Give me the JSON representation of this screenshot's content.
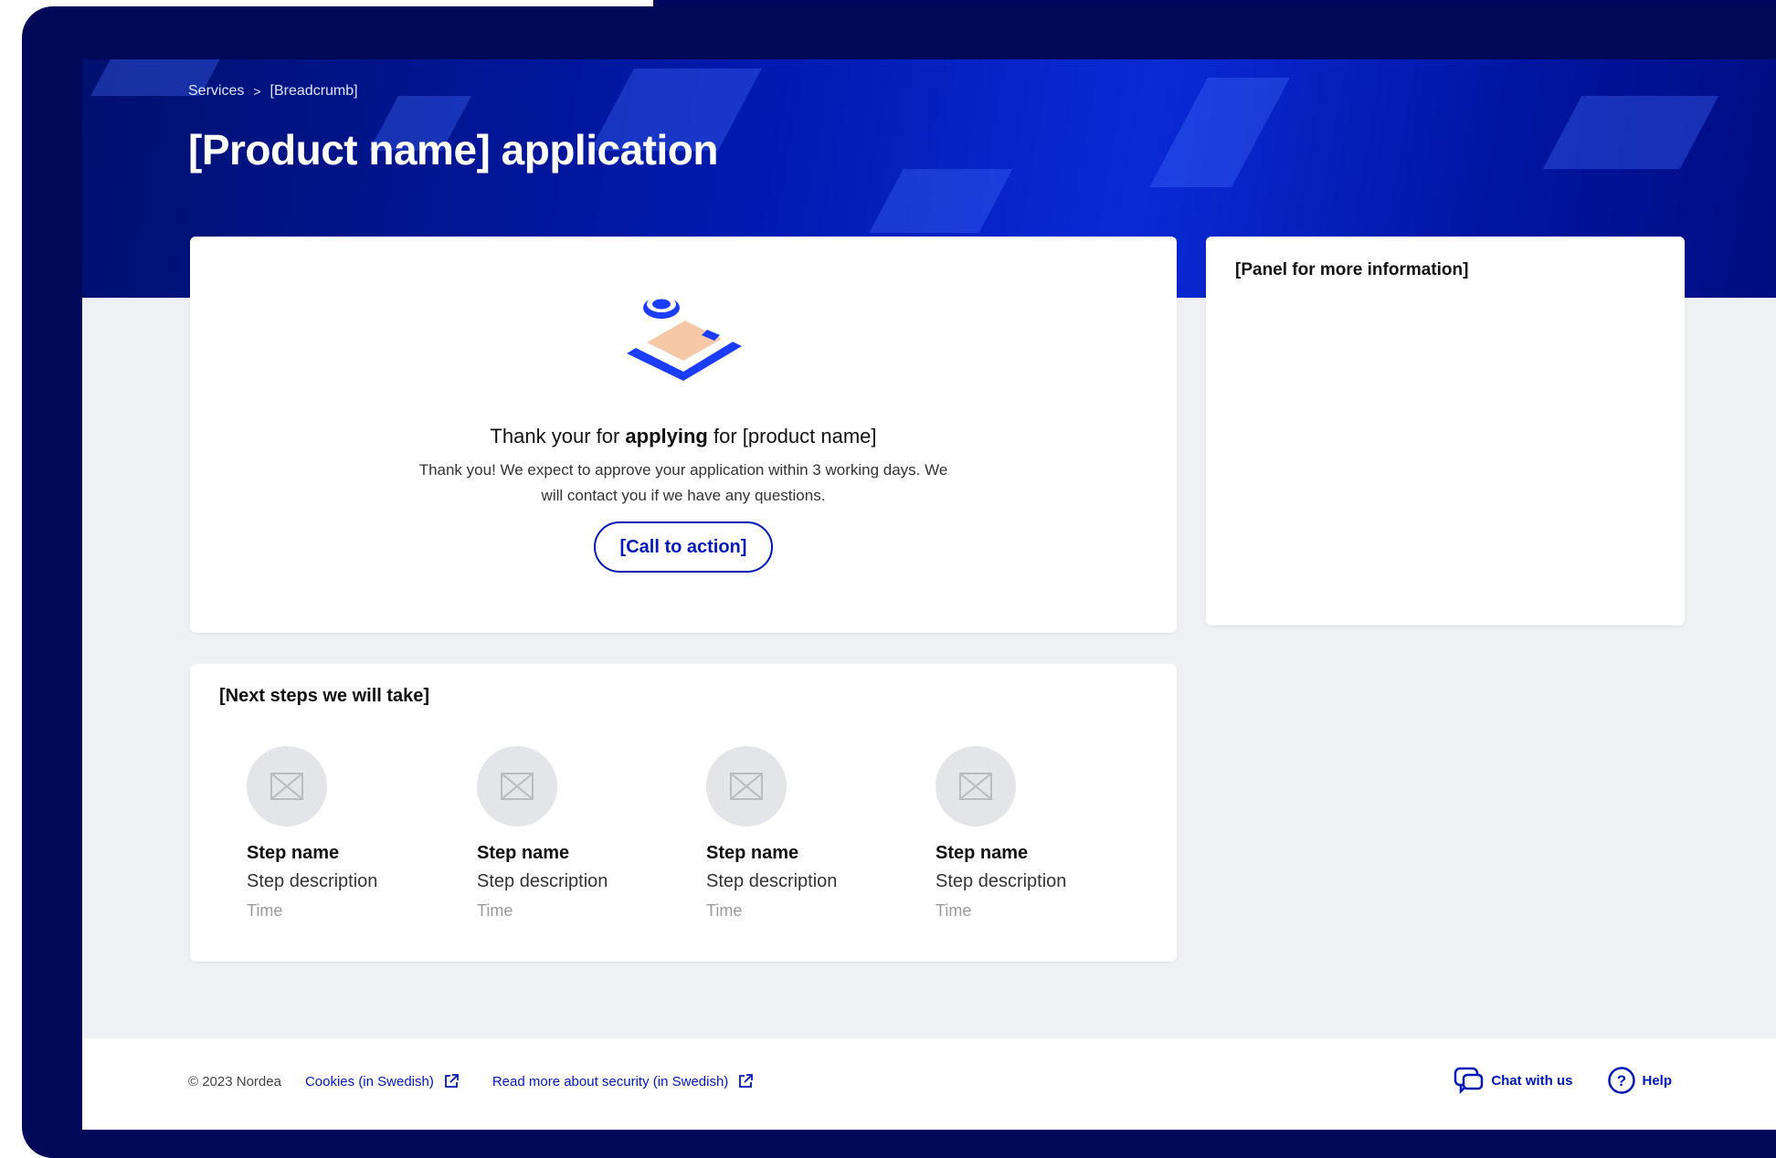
{
  "breadcrumb": {
    "root": "Services",
    "separator": ">",
    "current": "[Breadcrumb]"
  },
  "page_title": "[Product name] application",
  "confirmation": {
    "title_pre": "Thank your for ",
    "title_bold": "applying",
    "title_post": " for [product name]",
    "body": "Thank you! We expect to approve your application within 3 working days. We will contact you if we have any questions.",
    "cta_label": "[Call to action]"
  },
  "side_panel": {
    "title": "[Panel for more information]"
  },
  "next_steps": {
    "title": "[Next steps we will take]",
    "steps": [
      {
        "name": "Step name",
        "description": "Step description",
        "time": "Time",
        "icon": "image-placeholder-icon"
      },
      {
        "name": "Step name",
        "description": "Step description",
        "time": "Time",
        "icon": "image-placeholder-icon"
      },
      {
        "name": "Step name",
        "description": "Step description",
        "time": "Time",
        "icon": "image-placeholder-icon"
      },
      {
        "name": "Step name",
        "description": "Step description",
        "time": "Time",
        "icon": "image-placeholder-icon"
      }
    ]
  },
  "footer": {
    "copyright": "© 2023 Nordea",
    "cookies_link": "Cookies (in Swedish)",
    "security_link": "Read more about security (in Swedish)",
    "chat_label": "Chat with us",
    "help_label": "Help"
  },
  "colors": {
    "brand_navy": "#000858",
    "hero_blue": "#0a2ad6",
    "link_blue": "#0017b8",
    "page_bg": "#eef0f3"
  }
}
